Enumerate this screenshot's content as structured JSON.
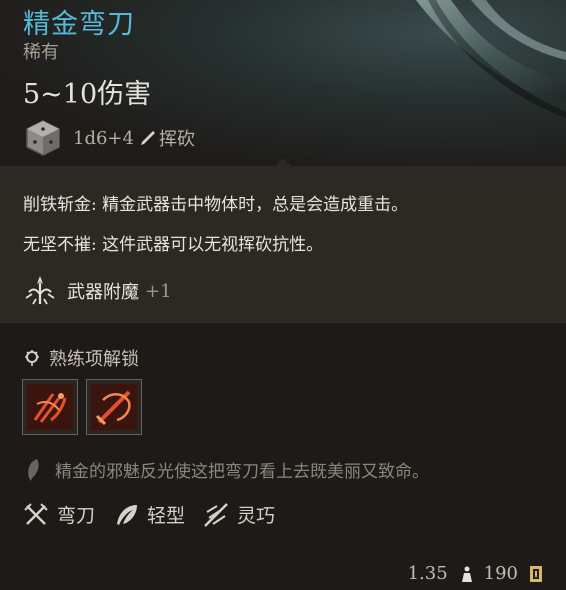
{
  "item": {
    "name": "精金弯刀",
    "rarity": "稀有",
    "damage": "5~10伤害",
    "dice": "1d6+4",
    "damage_type": "挥砍"
  },
  "passives": [
    "削铁斩金: 精金武器击中物体时，总是会造成重击。",
    "无坚不摧: 这件武器可以无视挥砍抗性。"
  ],
  "enchantment": {
    "label": "武器附魔",
    "value": "+1"
  },
  "proficiency": {
    "label": "熟练项解锁"
  },
  "flavor": "精金的邪魅反光使这把弯刀看上去既美丽又致命。",
  "tags": [
    {
      "icon": "crossed-swords-icon",
      "label": "弯刀"
    },
    {
      "icon": "feather-icon",
      "label": "轻型"
    },
    {
      "icon": "finesse-icon",
      "label": "灵巧"
    }
  ],
  "footer": {
    "weight": "1.35",
    "price": "190"
  },
  "colors": {
    "title": "#56b9d8",
    "accent_red": "#d0452b",
    "background": "#1d1a18"
  }
}
